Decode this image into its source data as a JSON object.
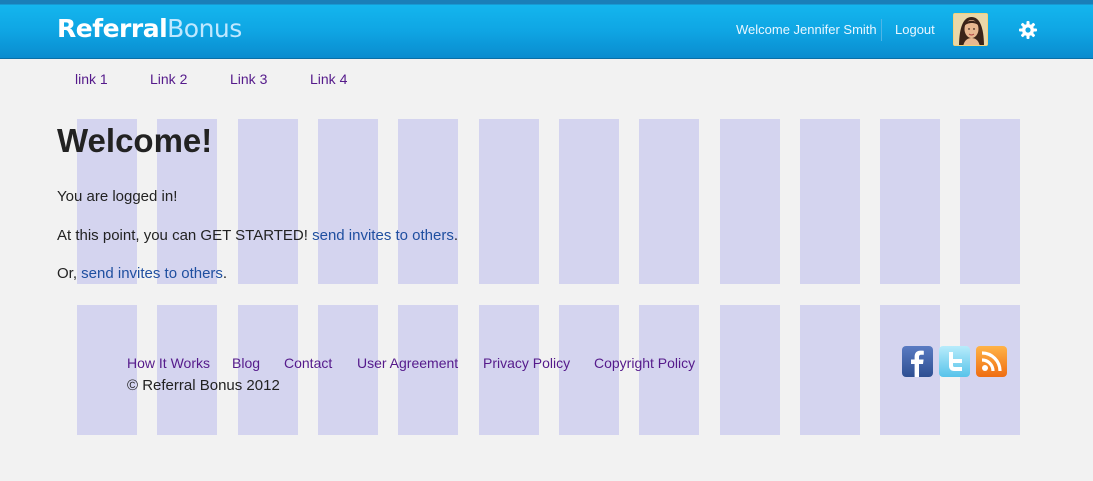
{
  "header": {
    "logo_part1": "Referral",
    "logo_part2": "Bonus",
    "welcome_text": "Welcome Jennifer Smith",
    "logout_label": "Logout"
  },
  "nav": {
    "links": [
      "link 1",
      "Link 2",
      "Link 3",
      "Link 4"
    ]
  },
  "main": {
    "title": "Welcome!",
    "logged_in_text": "You are logged in!",
    "line2_prefix": "At this point, you can GET STARTED! ",
    "line2_link": "send invites to others",
    "line2_suffix": ".",
    "line3_prefix": "Or, ",
    "line3_link": "send invites to others",
    "line3_suffix": "."
  },
  "footer": {
    "links": [
      "How It Works",
      "Blog",
      "Contact",
      "User Agreement",
      "Privacy Policy",
      "Copyright Policy"
    ],
    "copyright": "© Referral Bonus 2012"
  },
  "social": {
    "icons": [
      "facebook-icon",
      "twitter-icon",
      "rss-icon"
    ]
  },
  "colors": {
    "header_blue": "#0fa6e4",
    "link_purple": "#551a8b",
    "link_blue": "#1f4fa0",
    "overlay_lavender": "#b6b6ec"
  }
}
